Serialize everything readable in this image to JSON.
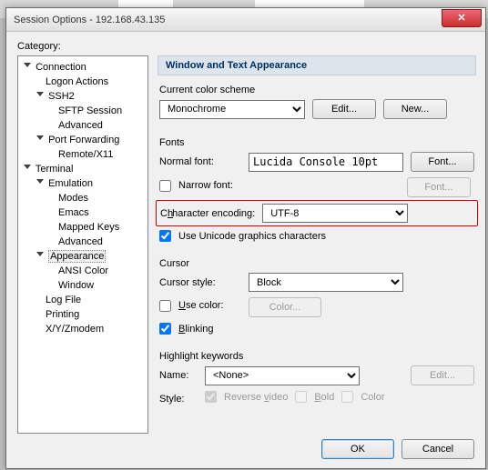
{
  "window": {
    "title": "Session Options - 192.168.43.135",
    "close_glyph": "✕"
  },
  "category_label": "Category:",
  "tree": {
    "connection": "Connection",
    "logon_actions": "Logon Actions",
    "ssh2": "SSH2",
    "sftp_session": "SFTP Session",
    "advanced1": "Advanced",
    "port_forwarding": "Port Forwarding",
    "remote_x11": "Remote/X11",
    "terminal": "Terminal",
    "emulation": "Emulation",
    "modes": "Modes",
    "emacs": "Emacs",
    "mapped_keys": "Mapped Keys",
    "advanced2": "Advanced",
    "appearance": "Appearance",
    "ansi_color": "ANSI Color",
    "window": "Window",
    "log_file": "Log File",
    "printing": "Printing",
    "xyz": "X/Y/Zmodem"
  },
  "header": "Window and Text Appearance",
  "scheme": {
    "label": "Current color scheme",
    "value": "Monochrome",
    "edit": "Edit...",
    "new": "New..."
  },
  "fonts": {
    "title": "Fonts",
    "normal_label": "Normal font:",
    "normal_value": "Lucida Console 10pt",
    "font_btn": "Font...",
    "narrow_label": "Narrow font:",
    "encoding_label_pre": "C",
    "encoding_label_mid": "haracter encoding:",
    "encoding_value": "UTF-8",
    "unicode_label": "Use Unicode graphics characters"
  },
  "cursor": {
    "title": "Cursor",
    "style_label": "Cursor style:",
    "style_value": "Block",
    "use_color_pre": "U",
    "use_color_rest": "se color:",
    "color_btn": "Color...",
    "blinking_pre": "B",
    "blinking_rest": "linking"
  },
  "highlight": {
    "title": "Highlight keywords",
    "name_label": "Name:",
    "name_value": "<None>",
    "edit_btn": "Edit...",
    "style_label": "Style:",
    "reverse_pre": "Reverse ",
    "reverse_u": "v",
    "reverse_post": "ideo",
    "bold_u": "B",
    "bold_rest": "old",
    "color": "Color"
  },
  "footer": {
    "ok": "OK",
    "cancel": "Cancel"
  }
}
